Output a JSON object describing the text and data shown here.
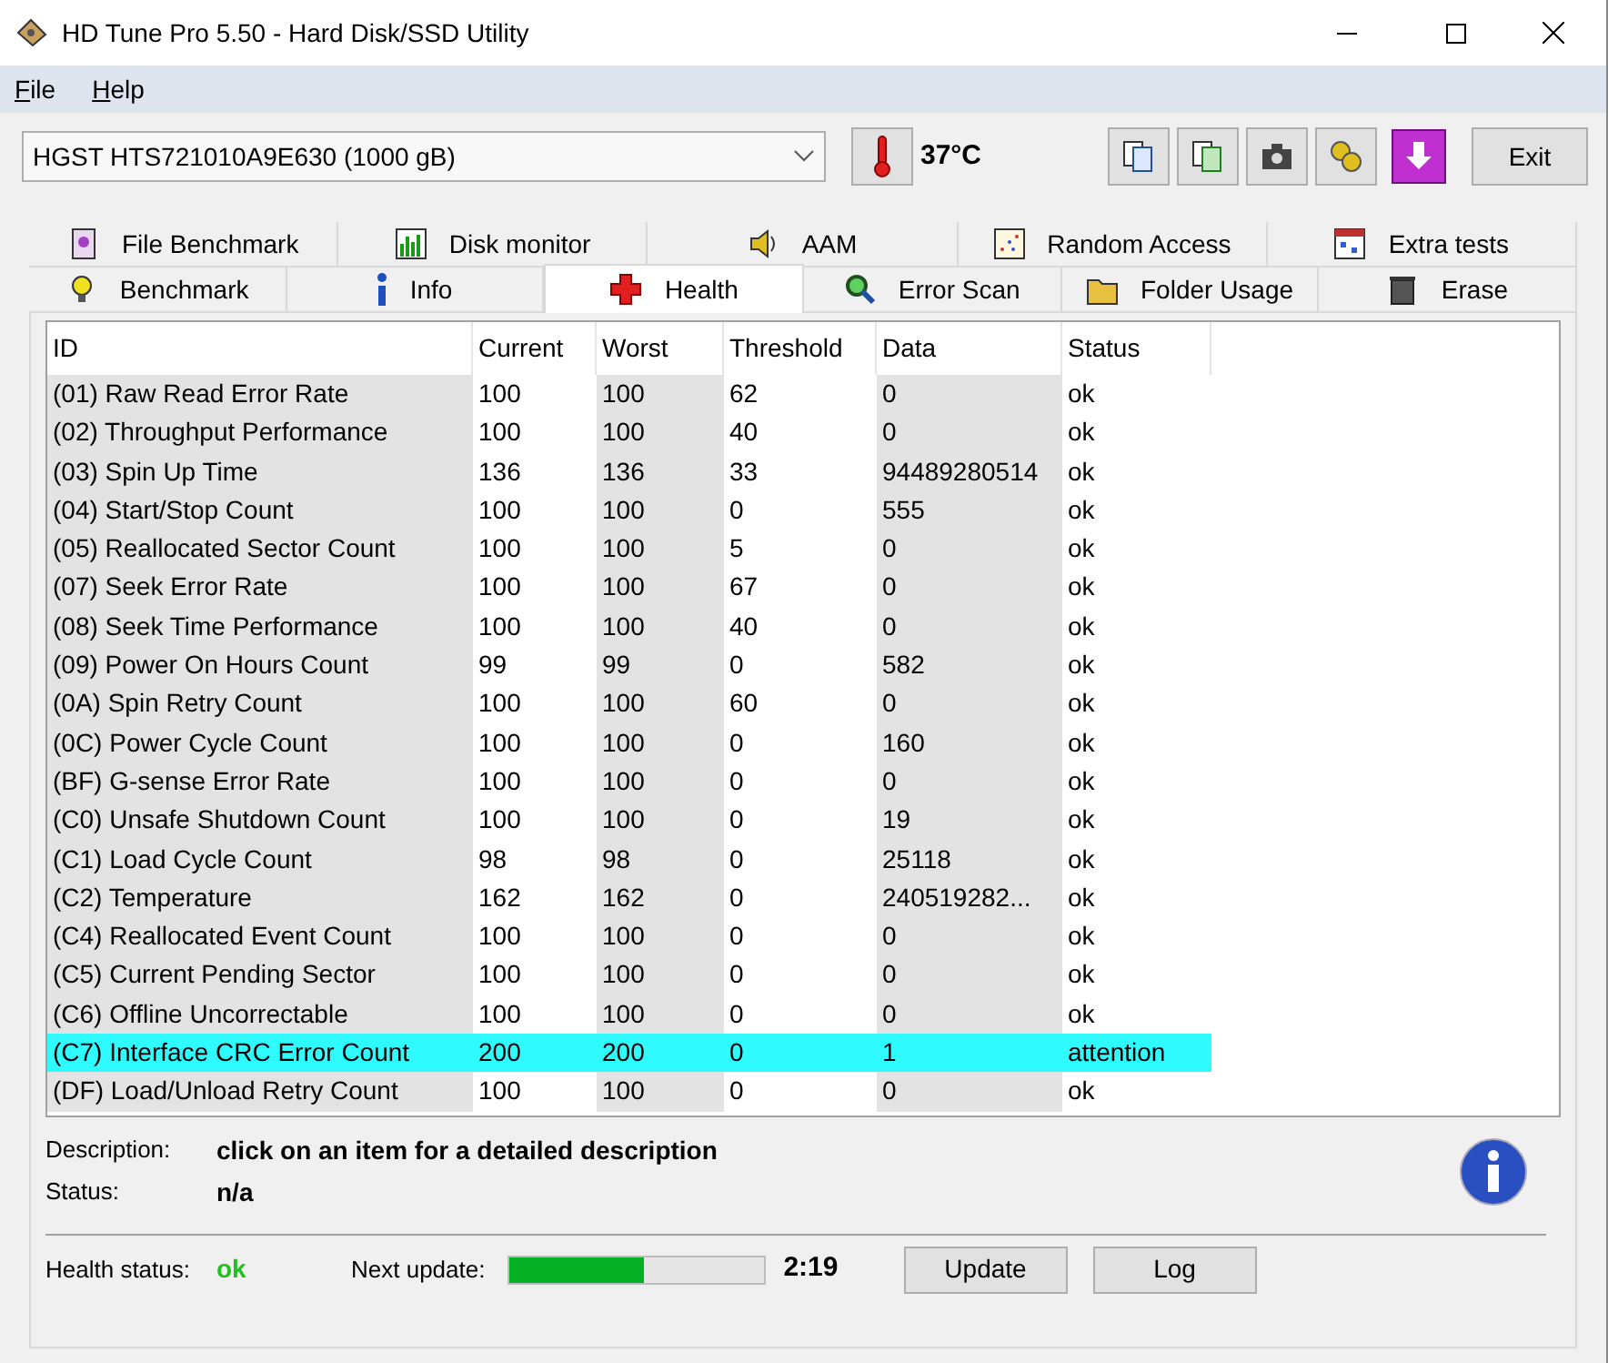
{
  "window": {
    "title": "HD Tune Pro 5.50 - Hard Disk/SSD Utility"
  },
  "menu": [
    {
      "label": "File"
    },
    {
      "label": "Help"
    }
  ],
  "toolbar": {
    "drive": "HGST HTS721010A9E630 (1000 gB)",
    "temperature": "37°C",
    "exit": "Exit"
  },
  "tabs_top": [
    {
      "label": "File Benchmark",
      "selected": false
    },
    {
      "label": "Disk monitor",
      "selected": false
    },
    {
      "label": "AAM",
      "selected": false
    },
    {
      "label": "Random Access",
      "selected": false
    },
    {
      "label": "Extra tests",
      "selected": false
    }
  ],
  "tabs_bottom": [
    {
      "label": "Benchmark",
      "selected": false
    },
    {
      "label": "Info",
      "selected": false
    },
    {
      "label": "Health",
      "selected": true
    },
    {
      "label": "Error Scan",
      "selected": false
    },
    {
      "label": "Folder Usage",
      "selected": false
    },
    {
      "label": "Erase",
      "selected": false
    }
  ],
  "table": {
    "columns": [
      "ID",
      "Current",
      "Worst",
      "Threshold",
      "Data",
      "Status"
    ],
    "rows": [
      {
        "cells": [
          "(01) Raw Read Error Rate",
          "100",
          "100",
          "62",
          "0",
          "ok"
        ],
        "highlighted": false
      },
      {
        "cells": [
          "(02) Throughput Performance",
          "100",
          "100",
          "40",
          "0",
          "ok"
        ],
        "highlighted": false
      },
      {
        "cells": [
          "(03) Spin Up Time",
          "136",
          "136",
          "33",
          "94489280514",
          "ok"
        ],
        "highlighted": false
      },
      {
        "cells": [
          "(04) Start/Stop Count",
          "100",
          "100",
          "0",
          "555",
          "ok"
        ],
        "highlighted": false
      },
      {
        "cells": [
          "(05) Reallocated Sector Count",
          "100",
          "100",
          "5",
          "0",
          "ok"
        ],
        "highlighted": false
      },
      {
        "cells": [
          "(07) Seek Error Rate",
          "100",
          "100",
          "67",
          "0",
          "ok"
        ],
        "highlighted": false
      },
      {
        "cells": [
          "(08) Seek Time Performance",
          "100",
          "100",
          "40",
          "0",
          "ok"
        ],
        "highlighted": false
      },
      {
        "cells": [
          "(09) Power On Hours Count",
          "99",
          "99",
          "0",
          "582",
          "ok"
        ],
        "highlighted": false
      },
      {
        "cells": [
          "(0A) Spin Retry Count",
          "100",
          "100",
          "60",
          "0",
          "ok"
        ],
        "highlighted": false
      },
      {
        "cells": [
          "(0C) Power Cycle Count",
          "100",
          "100",
          "0",
          "160",
          "ok"
        ],
        "highlighted": false
      },
      {
        "cells": [
          "(BF) G-sense Error Rate",
          "100",
          "100",
          "0",
          "0",
          "ok"
        ],
        "highlighted": false
      },
      {
        "cells": [
          "(C0) Unsafe Shutdown Count",
          "100",
          "100",
          "0",
          "19",
          "ok"
        ],
        "highlighted": false
      },
      {
        "cells": [
          "(C1) Load Cycle Count",
          "98",
          "98",
          "0",
          "25118",
          "ok"
        ],
        "highlighted": false
      },
      {
        "cells": [
          "(C2) Temperature",
          "162",
          "162",
          "0",
          "240519282...",
          "ok"
        ],
        "highlighted": false
      },
      {
        "cells": [
          "(C4) Reallocated Event Count",
          "100",
          "100",
          "0",
          "0",
          "ok"
        ],
        "highlighted": false
      },
      {
        "cells": [
          "(C5) Current Pending Sector",
          "100",
          "100",
          "0",
          "0",
          "ok"
        ],
        "highlighted": false
      },
      {
        "cells": [
          "(C6) Offline Uncorrectable",
          "100",
          "100",
          "0",
          "0",
          "ok"
        ],
        "highlighted": false
      },
      {
        "cells": [
          "(C7) Interface CRC Error Count",
          "200",
          "200",
          "0",
          "1",
          "attention"
        ],
        "highlighted": true
      },
      {
        "cells": [
          "(DF) Load/Unload Retry Count",
          "100",
          "100",
          "0",
          "0",
          "ok"
        ],
        "highlighted": false
      }
    ]
  },
  "details": {
    "description_label": "Description:",
    "description": "click on an item for a detailed description",
    "status_label": "Status:",
    "status": "n/a"
  },
  "footer": {
    "health_label": "Health status:",
    "health": "ok",
    "next_label": "Next update:",
    "level": 0.53,
    "time": "2:19",
    "buttons": [
      "Update",
      "Log"
    ]
  }
}
